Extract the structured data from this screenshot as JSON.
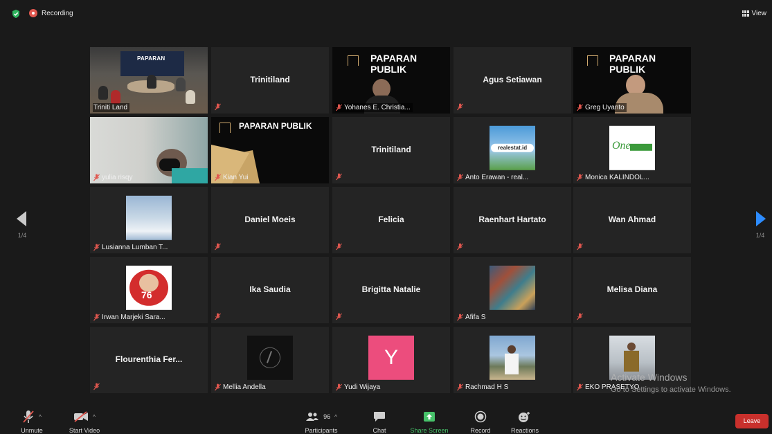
{
  "top_bar": {
    "recording_label": "Recording",
    "view_label": "View"
  },
  "pager": {
    "left": "1/4",
    "right": "1/4"
  },
  "tiles": [
    {
      "name": "Triniti Land",
      "kind": "video-meeting"
    },
    {
      "name": "Trinitiland",
      "kind": "name-only"
    },
    {
      "name": "Yohanes E. Christia...",
      "kind": "video-slide",
      "slide_title": "PAPARAN",
      "slide_title2": "PUBLIK"
    },
    {
      "name": "Agus Setiawan",
      "kind": "name-only"
    },
    {
      "name": "Greg Uyanto",
      "kind": "video-slide",
      "slide_title": "PAPARAN",
      "slide_title2": "PUBLIK"
    },
    {
      "name": "yulia risqy",
      "kind": "video-person"
    },
    {
      "name": "Kian Yui",
      "kind": "slide",
      "slide_title": "PAPARAN PUBLIK"
    },
    {
      "name": "Trinitiland",
      "kind": "name-only"
    },
    {
      "name": "Anto Erawan - real...",
      "kind": "avatar",
      "avatar_text": "realestat.id"
    },
    {
      "name": "Monica KALINDOL...",
      "kind": "avatar",
      "avatar_text": "One"
    },
    {
      "name": "Lusianna Lumban T...",
      "kind": "avatar"
    },
    {
      "name": "Daniel Moeis",
      "kind": "name-only"
    },
    {
      "name": "Felicia",
      "kind": "name-only"
    },
    {
      "name": "Raenhart Hartato",
      "kind": "name-only"
    },
    {
      "name": "Wan Ahmad",
      "kind": "name-only"
    },
    {
      "name": "Irwan Marjeki Sara...",
      "kind": "avatar",
      "avatar_text": "76"
    },
    {
      "name": "Ika Saudia",
      "kind": "name-only"
    },
    {
      "name": "Brigitta Natalie",
      "kind": "name-only"
    },
    {
      "name": "Afifa S",
      "kind": "avatar"
    },
    {
      "name": "Melisa Diana",
      "kind": "name-only"
    },
    {
      "name": "Flourenthia  Fer...",
      "kind": "name-only"
    },
    {
      "name": "Mellia Andella",
      "kind": "avatar"
    },
    {
      "name": "Yudi Wijaya",
      "kind": "avatar",
      "avatar_text": "Y"
    },
    {
      "name": "Rachmad H S",
      "kind": "avatar"
    },
    {
      "name": "EKO PRASETYO",
      "kind": "avatar"
    }
  ],
  "toolbar": {
    "unmute": "Unmute",
    "start_video": "Start Video",
    "participants": "Participants",
    "participants_count": "96",
    "chat": "Chat",
    "share_screen": "Share Screen",
    "record": "Record",
    "reactions": "Reactions",
    "leave": "Leave"
  },
  "watermark": {
    "line1": "Activate Windows",
    "line2": "Go to Settings to activate Windows."
  },
  "colors": {
    "active_speaker": "#c5e05a",
    "share_green": "#47c26a",
    "leave_red": "#c9302c",
    "muted_red": "#e0574f"
  }
}
